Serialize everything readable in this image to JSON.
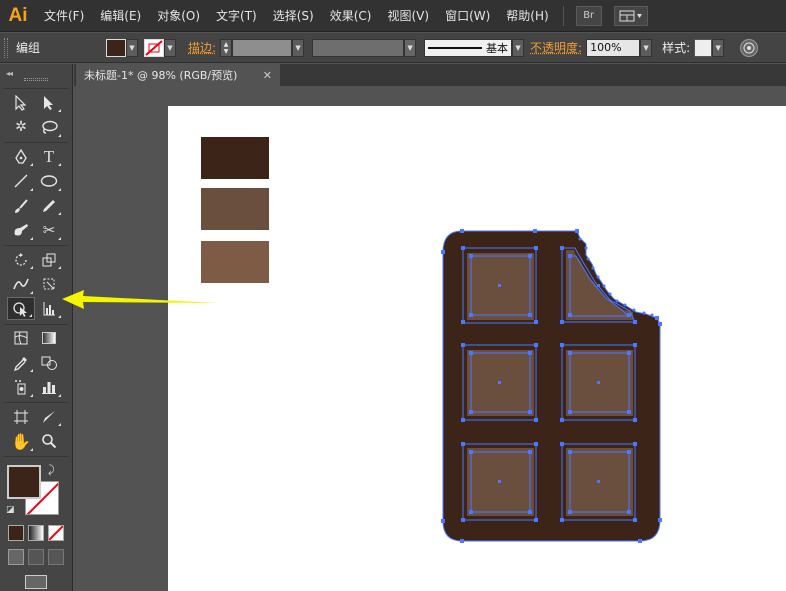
{
  "app": {
    "logo": "Ai"
  },
  "menu": {
    "items": [
      "文件(F)",
      "编辑(E)",
      "对象(O)",
      "文字(T)",
      "选择(S)",
      "效果(C)",
      "视图(V)",
      "窗口(W)",
      "帮助(H)"
    ],
    "bridge_button": "Br",
    "arrange_icon": "arrange-documents-icon"
  },
  "controlbar": {
    "mode": "编组",
    "fill_color": "#3c2418",
    "stroke_label": "描边:",
    "stroke_weight": "",
    "brush_style": "",
    "stroke_profile": "基本",
    "opacity_label": "不透明度:",
    "opacity_value": "100%",
    "style_label": "样式:"
  },
  "document": {
    "tab_title": "未标题-1* @ 98% (RGB/预览)",
    "close_glyph": "✕"
  },
  "colors": {
    "swatch_dark": "#3c2418",
    "swatch_mid": "#6a4e3e",
    "swatch_light": "#7e5b44",
    "chocolate_base": "#3c2418",
    "chocolate_square": "#6a4e3e",
    "selection": "#4a78ff",
    "arrow": "#f5f500"
  },
  "toolbox": {
    "fill_color": "#3c2418",
    "stroke_color": "none",
    "tools": [
      [
        "selection-tool-icon",
        "direct-selection-tool-icon"
      ],
      [
        "magic-wand-tool-icon",
        "lasso-tool-icon"
      ],
      [
        "pen-tool-icon",
        "type-tool-icon"
      ],
      [
        "line-segment-tool-icon",
        "ellipse-tool-icon"
      ],
      [
        "paintbrush-tool-icon",
        "pencil-tool-icon"
      ],
      [
        "blob-brush-tool-icon",
        "scissors-tool-icon"
      ],
      [
        "rotate-tool-icon",
        "scale-tool-icon"
      ],
      [
        "width-tool-icon",
        "free-transform-tool-icon"
      ],
      [
        "shape-builder-tool-icon",
        "perspective-grid-tool-icon"
      ],
      [
        "mesh-tool-icon",
        "gradient-tool-icon"
      ],
      [
        "eyedropper-tool-icon",
        "blend-tool-icon"
      ],
      [
        "symbol-sprayer-tool-icon",
        "column-graph-tool-icon"
      ],
      [
        "artboard-tool-icon",
        "slice-tool-icon"
      ],
      [
        "hand-tool-icon",
        "zoom-tool-icon"
      ]
    ]
  }
}
